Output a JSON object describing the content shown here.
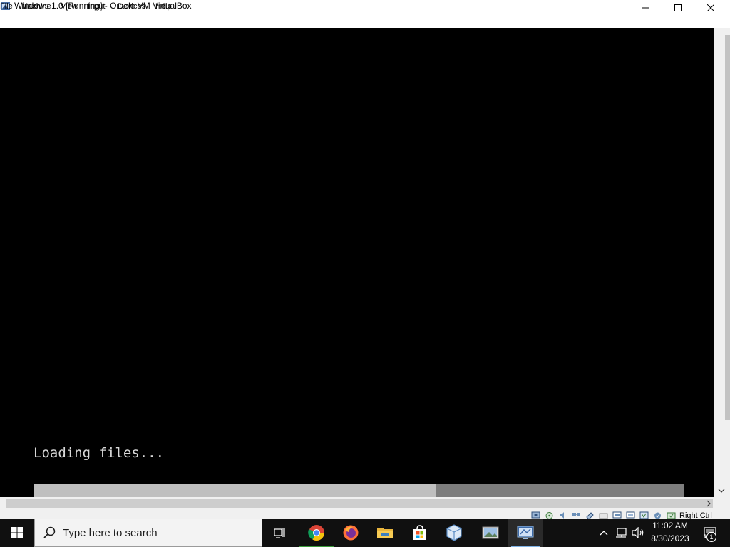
{
  "window": {
    "title": "Windows 1.0 [Running] - Oracle VM VirtualBox",
    "icon": "virtualbox-icon",
    "controls": [
      "minimize-icon",
      "maximize-icon",
      "close-icon"
    ]
  },
  "menu": {
    "items": [
      {
        "label": "File"
      },
      {
        "label": "Machine"
      },
      {
        "label": "View"
      },
      {
        "label": "Input"
      },
      {
        "label": "Devices"
      },
      {
        "label": "Help"
      }
    ]
  },
  "vm_screen": {
    "background": "#000000",
    "loading_text": "Loading files...",
    "progress_fraction": 0.62,
    "progress_fill_color": "#bfbfbf",
    "progress_track_color": "#7d7d7d"
  },
  "status_bar": {
    "icons": [
      "hard-disk-icon",
      "optical-drive-icon",
      "audio-icon",
      "network-icon",
      "usb-icon",
      "shared-folders-icon",
      "display-icon",
      "recording-icon",
      "cpu-icon",
      "mouse-integration-icon",
      "keyboard-icon"
    ],
    "host_key": "Right Ctrl"
  },
  "taskbar": {
    "search_placeholder": "Type here to search",
    "apps": [
      "task-view-icon",
      "chrome-icon",
      "firefox-icon",
      "file-explorer-icon",
      "microsoft-store-icon",
      "virtualbox-manager-icon",
      "photos-icon",
      "virtualbox-vm-icon"
    ],
    "active_app": "virtualbox-vm-icon",
    "clock": {
      "time": "11:02 AM",
      "date": "8/30/2023"
    },
    "notification_count": "1",
    "tray_icons": [
      "show-hidden-icons-icon",
      "network-tray-icon",
      "volume-icon"
    ]
  },
  "colors": {
    "taskbar_bg": "#101010",
    "accent": "#7fb2e5"
  }
}
